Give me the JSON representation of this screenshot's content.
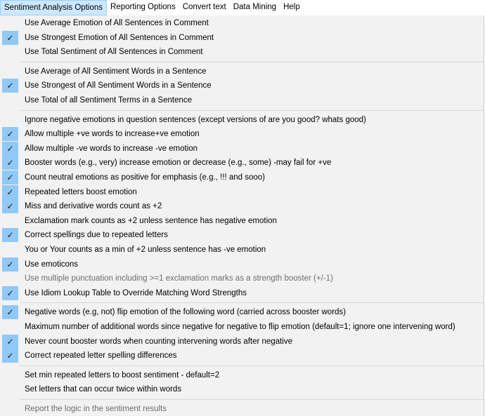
{
  "menubar": {
    "items": [
      {
        "label": "Sentiment Analysis Options",
        "active": true
      },
      {
        "label": "Reporting Options"
      },
      {
        "label": "Convert text"
      },
      {
        "label": "Data Mining"
      },
      {
        "label": "Help"
      }
    ]
  },
  "check_icon": "✓",
  "menu": {
    "groups": [
      {
        "items": [
          {
            "label": "Use Average Emotion of All Sentences in Comment",
            "checked": false
          },
          {
            "label": "Use Strongest Emotion of All Sentences in Comment",
            "checked": true
          },
          {
            "label": "Use Total Sentiment of All Sentences in Comment",
            "checked": false
          }
        ]
      },
      {
        "items": [
          {
            "label": "Use Average of All Sentiment Words in a Sentence",
            "checked": false
          },
          {
            "label": "Use Strongest of All Sentiment Words in a Sentence",
            "checked": true
          },
          {
            "label": "Use Total of all Sentiment Terms in a Sentence",
            "checked": false
          }
        ]
      },
      {
        "items": [
          {
            "label": "Ignore negative emotions in question sentences (except versions of are you good? whats good)",
            "checked": false
          },
          {
            "label": "Allow multiple +ve words to increase+ve emotion",
            "checked": true
          },
          {
            "label": "Allow multiple -ve words to increase -ve emotion",
            "checked": true
          },
          {
            "label": "Booster words (e.g., very) increase emotion or decrease (e.g., some) -may fail for +ve",
            "checked": true
          },
          {
            "label": "Count neutral emotions as positive for emphasis (e.g., !!! and sooo)",
            "checked": true
          },
          {
            "label": "Repeated letters boost emotion",
            "checked": true
          },
          {
            "label": "Miss and derivative words count as +2",
            "checked": true
          },
          {
            "label": "Exclamation mark counts as +2 unless sentence has negative emotion",
            "checked": false
          },
          {
            "label": "Correct spellings due to repeated letters",
            "checked": true
          },
          {
            "label": "You or Your counts as a min of +2 unless sentence has -ve emotion",
            "checked": false
          },
          {
            "label": "Use emoticons",
            "checked": true
          },
          {
            "label": "Use multiple punctuation including >=1  exclamation marks as a strength booster (+/-1)",
            "checked": false,
            "disabled": true
          },
          {
            "label": "Use Idiom Lookup Table to Override Matching Word Strengths",
            "checked": true
          }
        ]
      },
      {
        "items": [
          {
            "label": "Negative words (e.g, not) flip emotion of the following word (carried across booster words)",
            "checked": true
          },
          {
            "label": "Maximum number of additional words since negative for negative to flip emotion (default=1; ignore one intervening word)",
            "checked": false
          },
          {
            "label": "Never count booster words when counting intervening words after negative",
            "checked": true
          },
          {
            "label": "Correct repeated letter spelling differences",
            "checked": true
          }
        ]
      },
      {
        "items": [
          {
            "label": "Set min repeated letters to boost sentiment - default=2",
            "checked": false
          },
          {
            "label": "Set letters that can occur twice within words",
            "checked": false
          }
        ]
      },
      {
        "items": [
          {
            "label": "Report the logic in the sentiment results",
            "checked": false,
            "disabled": true
          }
        ]
      }
    ]
  }
}
